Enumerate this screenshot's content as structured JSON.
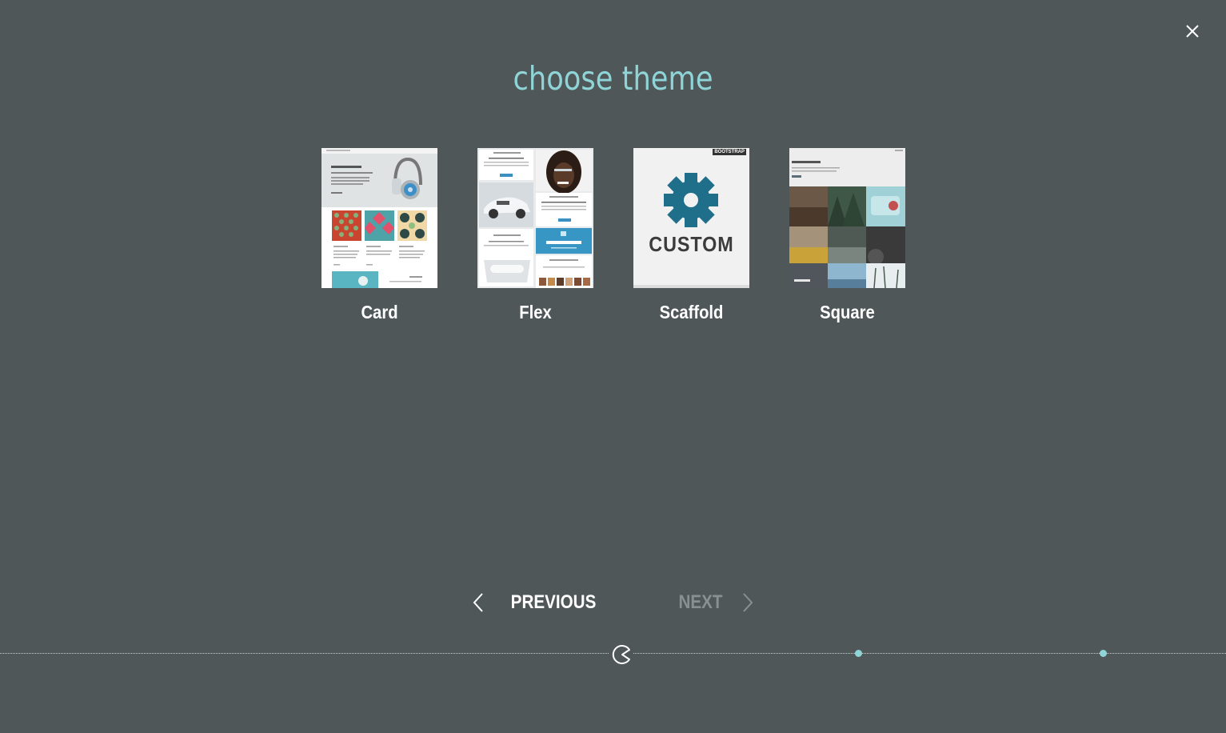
{
  "dialog": {
    "title": "choose theme"
  },
  "themes": [
    {
      "name": "Card"
    },
    {
      "name": "Flex"
    },
    {
      "name": "Scaffold",
      "badge": "BOOTSTRAP",
      "thumb_text": "CUSTOM"
    },
    {
      "name": "Square"
    }
  ],
  "navigation": {
    "previous_label": "PREVIOUS",
    "next_label": "NEXT"
  },
  "colors": {
    "background": "#4f5759",
    "accent": "#8fd4d6",
    "scaffold_gear": "#1f6f8b"
  }
}
